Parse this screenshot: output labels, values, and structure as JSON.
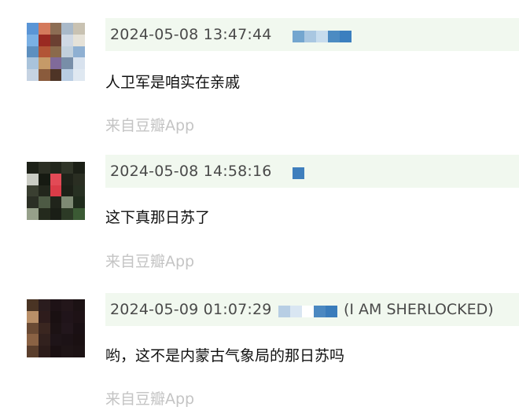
{
  "comments": [
    {
      "timestamp": "2024-05-08 13:47:44",
      "text": "人卫军是咱实在亲戚",
      "source": "来自豆瓣App",
      "avatar_colors": [
        "#5a95d6",
        "#d47a5c",
        "#8c6d54",
        "#a9b9c9",
        "#c9c2b2",
        "#7ab0e4",
        "#9a2a22",
        "#6b4032",
        "#cfd8e4",
        "#e6e2d8",
        "#5d8fbf",
        "#b25536",
        "#8a6a4c",
        "#c2d0dc",
        "#8fb0d2",
        "#a9c3db",
        "#c59a68",
        "#806a9a",
        "#788ea8",
        "#d8e2ee",
        "#c6d3e2",
        "#8a5b3c",
        "#4e3426",
        "#b9cde2",
        "#dfe8f1"
      ],
      "username_colors": [
        "#74a6cf",
        "#a9c7e1",
        "#c7dced",
        "#4c8bc2",
        "#3b7fbf"
      ]
    },
    {
      "timestamp": "2024-05-08 14:58:16",
      "text": "这下真那日苏了",
      "source": "来自豆瓣App",
      "avatar_colors": [
        "#1d2118",
        "#2c2f24",
        "#22261c",
        "#303528",
        "#1b1f16",
        "#caccc4",
        "#161a12",
        "#e24a56",
        "#1f231a",
        "#2a2e22",
        "#3a3f31",
        "#22261c",
        "#da3c48",
        "#1c2017",
        "#273022",
        "#2b2f25",
        "#4d5a44",
        "#20241b",
        "#7e8a74",
        "#1f2b1c",
        "#96a08a",
        "#242a1d",
        "#1a1e16",
        "#2c3a26",
        "#3b5a34"
      ],
      "username_colors": [
        "#3f7fbd"
      ]
    },
    {
      "timestamp": "2024-05-09 01:07:29",
      "text": "哟，这不是内蒙古气象局的那日苏吗",
      "source": "来自豆瓣App",
      "username_suffix": "(I AM SHERLOCKED)",
      "avatar_colors": [
        "#4a3424",
        "#2a1c1e",
        "#1e1216",
        "#23161a",
        "#1c1214",
        "#b98f68",
        "#2e1c1c",
        "#1a1012",
        "#20141a",
        "#1e1216",
        "#6a4a34",
        "#3a2620",
        "#1c1214",
        "#22161c",
        "#1a1014",
        "#8a6244",
        "#32211e",
        "#1e1418",
        "#1c1216",
        "#1a1012",
        "#5a3e2c",
        "#2c1c1a",
        "#1a1012",
        "#1e1416",
        "#1c1214"
      ],
      "username_colors": [
        "#b7cee4",
        "#d9e6f2",
        "#ffffff",
        "#4b88c1",
        "#3a7cbb"
      ]
    }
  ]
}
